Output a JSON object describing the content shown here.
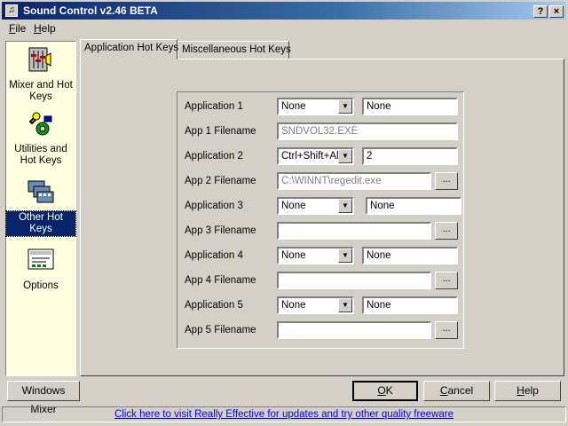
{
  "window": {
    "title": "Sound Control v2.46 BETA",
    "help_btn": "?",
    "close_btn": "×"
  },
  "menu": [
    {
      "label": "File",
      "underline": "F",
      "rest": "ile"
    },
    {
      "label": "Help",
      "underline": "H",
      "rest": "elp"
    }
  ],
  "sidebar": {
    "items": [
      {
        "label": "Mixer and Hot Keys",
        "icon": "mixer-icon",
        "selected": false
      },
      {
        "label": "Utilities and Hot Keys",
        "icon": "utilities-icon",
        "selected": false
      },
      {
        "label": "Other Hot Keys",
        "icon": "other-hotkeys-icon",
        "selected": true
      },
      {
        "label": "Options",
        "icon": "options-icon",
        "selected": false
      }
    ]
  },
  "tabs": [
    {
      "label": "Application Hot Keys",
      "active": true
    },
    {
      "label": "Miscellaneous Hot Keys",
      "active": false
    }
  ],
  "apps": [
    {
      "label": "Application 1",
      "combo": "None",
      "key": "None",
      "file_label": "App 1 Filename",
      "file": "SNDVOL32.EXE",
      "file_disabled": true,
      "browse": false
    },
    {
      "label": "Application 2",
      "combo": "Ctrl+Shift+Alt",
      "key": "2",
      "file_label": "App 2 Filename",
      "file": "C:\\WINNT\\regedit.exe",
      "file_disabled": true,
      "browse": true
    },
    {
      "label": "Application 3",
      "combo": "None",
      "key": "None",
      "file_label": "App 3 Filename",
      "file": "",
      "file_disabled": false,
      "browse": true
    },
    {
      "label": "Application 4",
      "combo": "None",
      "key": "None",
      "file_label": "App 4 Filename",
      "file": "",
      "file_disabled": false,
      "browse": true
    },
    {
      "label": "Application 5",
      "combo": "None",
      "key": "None",
      "file_label": "App 5 Filename",
      "file": "",
      "file_disabled": false,
      "browse": true
    }
  ],
  "browse_label": "...",
  "buttons": {
    "windows_mixer": "Windows Mixer",
    "ok": {
      "u": "O",
      "rest": "K"
    },
    "cancel": {
      "pre": "",
      "u": "C",
      "rest": "ancel"
    },
    "help": {
      "u": "H",
      "rest": "elp"
    }
  },
  "status_link": "Click here to visit Really Effective for updates and try other quality freeware"
}
